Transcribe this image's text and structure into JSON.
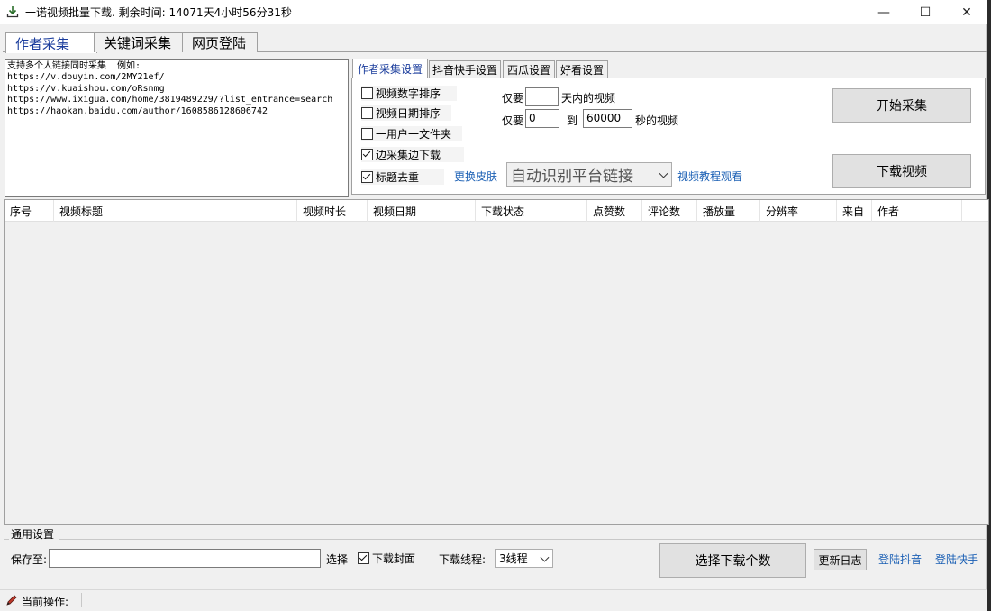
{
  "window": {
    "title": "一诺视频批量下载. 剩余时间: 14071天4小时56分31秒",
    "minimize_glyph": "—",
    "maximize_glyph": "☐",
    "close_glyph": "✕"
  },
  "main_tabs": [
    {
      "label": "作者采集",
      "active": true
    },
    {
      "label": "关键词采集",
      "active": false
    },
    {
      "label": "网页登陆",
      "active": false
    }
  ],
  "links_box": {
    "text": "支持多个人链接同时采集  例如:\nhttps://v.douyin.com/2MY21ef/\nhttps://v.kuaishou.com/oRsnmg\nhttps://www.ixigua.com/home/3819489229/?list_entrance=search\nhttps://haokan.baidu.com/author/1608586128606742"
  },
  "sub_tabs": [
    {
      "label": "作者采集设置",
      "active": true
    },
    {
      "label": "抖音快手设置",
      "active": false
    },
    {
      "label": "西瓜设置",
      "active": false
    },
    {
      "label": "好看设置",
      "active": false
    }
  ],
  "options": {
    "sort_by_number": {
      "label": "视频数字排序",
      "checked": false
    },
    "sort_by_date": {
      "label": "视频日期排序",
      "checked": false
    },
    "one_user_one_folder": {
      "label": "一用户一文件夹",
      "checked": false
    },
    "download_while_collecting": {
      "label": "边采集边下载",
      "checked": true
    },
    "dedupe_titles": {
      "label": "标题去重",
      "checked": true
    }
  },
  "filters": {
    "only_prefix": "仅要",
    "days_value": "",
    "days_suffix": "天内的视频",
    "duration_prefix": "仅要",
    "duration_min": "0",
    "to_label": "到",
    "duration_max": "60000",
    "duration_suffix": "秒的视频"
  },
  "skin_link": "更换皮肤",
  "platform_combo": "自动识别平台链接",
  "tutorial_link": "视频教程观看",
  "start_button": "开始采集",
  "download_button": "下载视频",
  "table": {
    "columns": [
      "序号",
      "视频标题",
      "视频时长",
      "视频日期",
      "下载状态",
      "点赞数",
      "评论数",
      "播放量",
      "分辨率",
      "来自",
      "作者"
    ]
  },
  "general": {
    "group_title": "通用设置",
    "save_label": "保存至:",
    "save_value": "",
    "choose_label": "选择",
    "download_cover": {
      "label": "下载封面",
      "checked": true
    },
    "threads_label": "下载线程:",
    "threads_value": "3线程",
    "select_count_button": "选择下载个数",
    "update_log_button": "更新日志",
    "login_douyin": "登陆抖音",
    "login_kuaishou": "登陆快手"
  },
  "status": {
    "label": "当前操作:",
    "value": ""
  },
  "colors": {
    "accent_link": "#1a5fb4",
    "active_tab_text": "#1a3c9c"
  }
}
